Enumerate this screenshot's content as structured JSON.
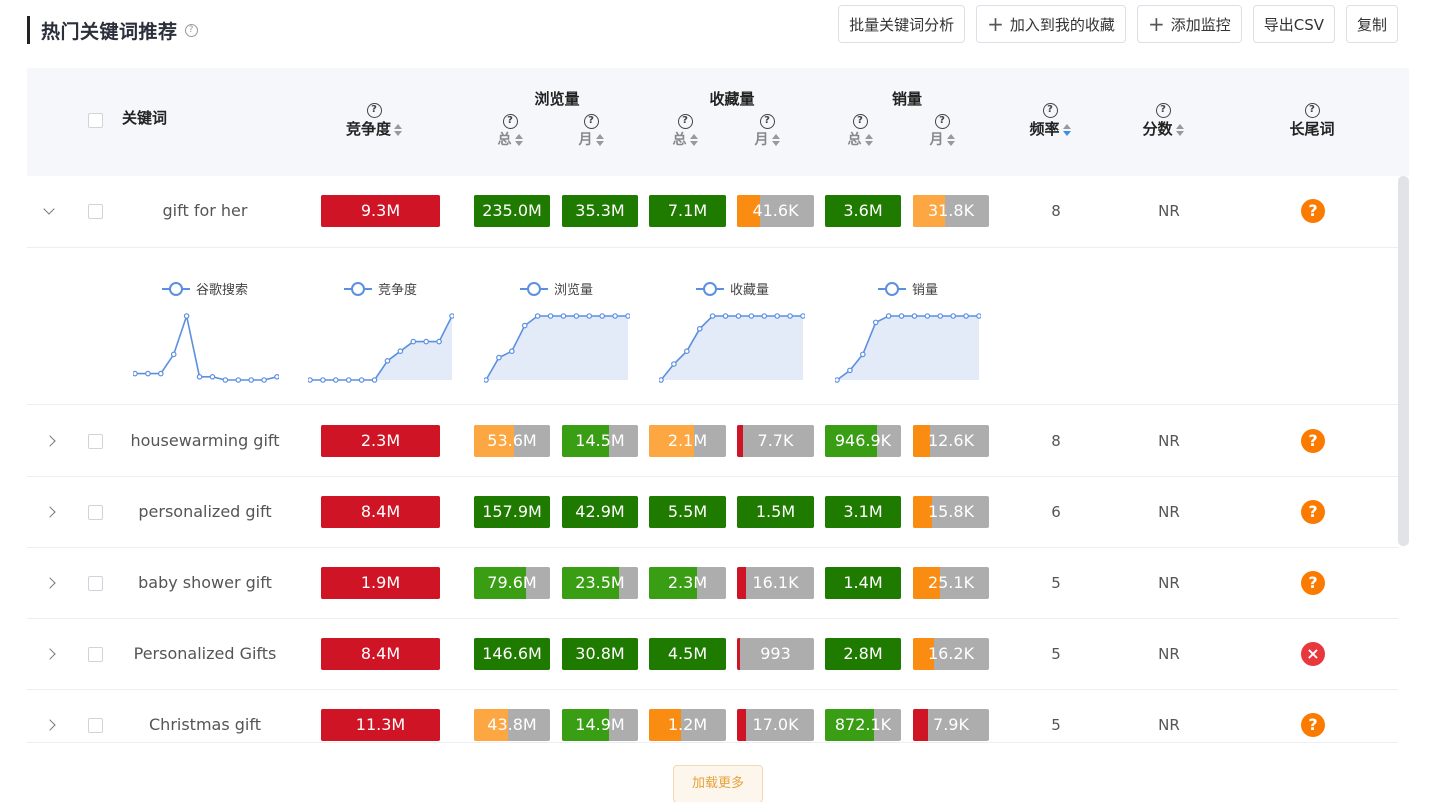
{
  "header": {
    "title": "热门关键词推荐",
    "help": "?",
    "buttons": [
      {
        "label": "批量关键词分析",
        "plus": false
      },
      {
        "label": "加入到我的收藏",
        "plus": true
      },
      {
        "label": "添加监控",
        "plus": true
      },
      {
        "label": "导出CSV",
        "plus": false
      },
      {
        "label": "复制",
        "plus": false
      }
    ]
  },
  "columns": {
    "keyword": "关键词",
    "competition": "竞争度",
    "views": "浏览量",
    "favorites": "收藏量",
    "sales": "销量",
    "total": "总",
    "month": "月",
    "frequency": "频率",
    "score": "分数",
    "longtail": "长尾词",
    "help": "?"
  },
  "colors": {
    "red": "#cf1426",
    "dark_green": "#1f7a00",
    "green": "#3a9e14",
    "orange": "#fb8c12",
    "light_orange": "#fda743",
    "gray": "#adadad",
    "longtail_question": "#fb7a00",
    "longtail_no": "#e8383d"
  },
  "rows": [
    {
      "keyword": "gift for her",
      "expanded": true,
      "cells": [
        {
          "label": "9.3M",
          "fill": 1.0,
          "color": "#cf1426"
        },
        {
          "label": "235.0M",
          "fill": 1.0,
          "color": "#1f7a00"
        },
        {
          "label": "35.3M",
          "fill": 1.0,
          "color": "#1f7a00"
        },
        {
          "label": "7.1M",
          "fill": 1.0,
          "color": "#1f7a00"
        },
        {
          "label": "41.6K",
          "fill": 0.3,
          "color": "#fb8c12"
        },
        {
          "label": "3.6M",
          "fill": 1.0,
          "color": "#1f7a00"
        },
        {
          "label": "31.8K",
          "fill": 0.42,
          "color": "#fda743"
        }
      ],
      "frequency": "8",
      "score": "NR",
      "longtail": "?",
      "longtail_type": "question"
    },
    {
      "keyword": "housewarming gift",
      "expanded": false,
      "cells": [
        {
          "label": "2.3M",
          "fill": 1.0,
          "color": "#cf1426"
        },
        {
          "label": "53.6M",
          "fill": 0.53,
          "color": "#fda743"
        },
        {
          "label": "14.5M",
          "fill": 0.62,
          "color": "#3a9e14"
        },
        {
          "label": "2.1M",
          "fill": 0.58,
          "color": "#fda743"
        },
        {
          "label": "7.7K",
          "fill": 0.08,
          "color": "#cf1426"
        },
        {
          "label": "946.9K",
          "fill": 0.68,
          "color": "#3a9e14"
        },
        {
          "label": "12.6K",
          "fill": 0.22,
          "color": "#fb8c12"
        }
      ],
      "frequency": "8",
      "score": "NR",
      "longtail": "?",
      "longtail_type": "question"
    },
    {
      "keyword": "personalized gift",
      "expanded": false,
      "cells": [
        {
          "label": "8.4M",
          "fill": 1.0,
          "color": "#cf1426"
        },
        {
          "label": "157.9M",
          "fill": 1.0,
          "color": "#1f7a00"
        },
        {
          "label": "42.9M",
          "fill": 1.0,
          "color": "#1f7a00"
        },
        {
          "label": "5.5M",
          "fill": 1.0,
          "color": "#1f7a00"
        },
        {
          "label": "1.5M",
          "fill": 1.0,
          "color": "#1f7a00"
        },
        {
          "label": "3.1M",
          "fill": 1.0,
          "color": "#1f7a00"
        },
        {
          "label": "15.8K",
          "fill": 0.25,
          "color": "#fb8c12"
        }
      ],
      "frequency": "6",
      "score": "NR",
      "longtail": "?",
      "longtail_type": "question"
    },
    {
      "keyword": "baby shower gift",
      "expanded": false,
      "cells": [
        {
          "label": "1.9M",
          "fill": 1.0,
          "color": "#cf1426"
        },
        {
          "label": "79.6M",
          "fill": 0.68,
          "color": "#3a9e14"
        },
        {
          "label": "23.5M",
          "fill": 0.75,
          "color": "#3a9e14"
        },
        {
          "label": "2.3M",
          "fill": 0.62,
          "color": "#3a9e14"
        },
        {
          "label": "16.1K",
          "fill": 0.12,
          "color": "#cf1426"
        },
        {
          "label": "1.4M",
          "fill": 1.0,
          "color": "#1f7a00"
        },
        {
          "label": "25.1K",
          "fill": 0.35,
          "color": "#fb8c12"
        }
      ],
      "frequency": "5",
      "score": "NR",
      "longtail": "?",
      "longtail_type": "question"
    },
    {
      "keyword": "Personalized Gifts",
      "expanded": false,
      "cells": [
        {
          "label": "8.4M",
          "fill": 1.0,
          "color": "#cf1426"
        },
        {
          "label": "146.6M",
          "fill": 1.0,
          "color": "#1f7a00"
        },
        {
          "label": "30.8M",
          "fill": 1.0,
          "color": "#1f7a00"
        },
        {
          "label": "4.5M",
          "fill": 1.0,
          "color": "#1f7a00"
        },
        {
          "label": "993",
          "fill": 0.02,
          "color": "#cf1426"
        },
        {
          "label": "2.8M",
          "fill": 1.0,
          "color": "#1f7a00"
        },
        {
          "label": "16.2K",
          "fill": 0.28,
          "color": "#fb8c12"
        }
      ],
      "frequency": "5",
      "score": "NR",
      "longtail": "×",
      "longtail_type": "no"
    },
    {
      "keyword": "Christmas gift",
      "expanded": false,
      "cells": [
        {
          "label": "11.3M",
          "fill": 1.0,
          "color": "#cf1426"
        },
        {
          "label": "43.8M",
          "fill": 0.45,
          "color": "#fda743"
        },
        {
          "label": "14.9M",
          "fill": 0.62,
          "color": "#3a9e14"
        },
        {
          "label": "1.2M",
          "fill": 0.42,
          "color": "#fb8c12"
        },
        {
          "label": "17.0K",
          "fill": 0.12,
          "color": "#cf1426"
        },
        {
          "label": "872.1K",
          "fill": 0.65,
          "color": "#3a9e14"
        },
        {
          "label": "7.9K",
          "fill": 0.2,
          "color": "#cf1426"
        }
      ],
      "frequency": "5",
      "score": "NR",
      "longtail": "?",
      "longtail_type": "question"
    }
  ],
  "chart_data": [
    {
      "type": "line",
      "series": [
        {
          "name": "谷歌搜索",
          "values": [
            1,
            1,
            1,
            4,
            10,
            0.5,
            0.5,
            0,
            0,
            0,
            0,
            0.5
          ]
        }
      ],
      "ylim": [
        0,
        10
      ],
      "area": false
    },
    {
      "type": "area",
      "series": [
        {
          "name": "竞争度",
          "values": [
            0,
            0,
            0,
            0,
            0,
            0,
            3,
            4.5,
            6,
            6,
            6,
            10
          ]
        }
      ],
      "ylim": [
        0,
        10
      ],
      "area": true
    },
    {
      "type": "area",
      "series": [
        {
          "name": "浏览量",
          "values": [
            0,
            3.5,
            4.5,
            8.5,
            10,
            10,
            10,
            10,
            10,
            10,
            10,
            10
          ]
        }
      ],
      "ylim": [
        0,
        10
      ],
      "area": true
    },
    {
      "type": "area",
      "series": [
        {
          "name": "收藏量",
          "values": [
            0,
            2.5,
            4.5,
            8,
            10,
            10,
            10,
            10,
            10,
            10,
            10,
            10
          ]
        }
      ],
      "ylim": [
        0,
        10
      ],
      "area": true
    },
    {
      "type": "area",
      "series": [
        {
          "name": "销量",
          "values": [
            0,
            1.5,
            4,
            9,
            10,
            10,
            10,
            10,
            10,
            10,
            10,
            10
          ]
        }
      ],
      "ylim": [
        0,
        10
      ],
      "area": true
    }
  ],
  "load_more": "加载更多"
}
